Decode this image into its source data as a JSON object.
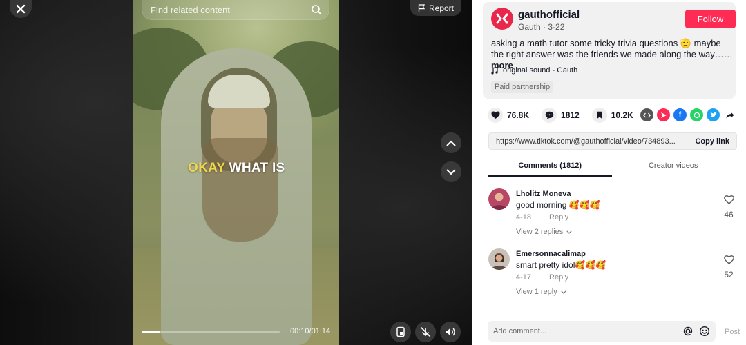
{
  "video": {
    "search_placeholder": "Find related content",
    "report_label": "Report",
    "caption_highlight": "OKAY",
    "caption_rest": "WHAT IS",
    "current_time": "00:10",
    "duration": "01:14",
    "time_display": "00:10/01:14",
    "progress_fraction": 0.135
  },
  "author": {
    "name": "gauthofficial",
    "subtitle": "Gauth · 3-22",
    "follow_label": "Follow",
    "description": "asking a math tutor some tricky trivia questions 🫡 maybe the right answer was the friends we made along the way……",
    "more_label": "more",
    "sound": "original sound - Gauth",
    "paid_label": "Paid partnership",
    "brand_color": "#e8274a"
  },
  "stats": {
    "likes": "76.8K",
    "comments": "1812",
    "saves": "10.2K"
  },
  "share_icons": [
    "embed-icon",
    "send-icon",
    "facebook-icon",
    "whatsapp-icon",
    "twitter-icon",
    "share-arrow-icon"
  ],
  "link": {
    "url": "https://www.tiktok.com/@gauthofficial/video/734893...",
    "copy_label": "Copy link"
  },
  "tabs": [
    {
      "label": "Comments (1812)",
      "active": true
    },
    {
      "label": "Creator videos",
      "active": false
    }
  ],
  "comments": [
    {
      "user": "Lholitz Moneva",
      "text": "good morning 🥰🥰🥰",
      "date": "4-18",
      "reply_label": "Reply",
      "replies_label": "View 2 replies",
      "likes": "46"
    },
    {
      "user": "Emersonnacalimap",
      "text": "smart pretty idol🥰🥰🥰",
      "date": "4-17",
      "reply_label": "Reply",
      "replies_label": "View 1 reply",
      "likes": "52"
    }
  ],
  "composer": {
    "placeholder": "Add comment...",
    "post_label": "Post"
  },
  "colors": {
    "accent": "#fe2c55",
    "caption_yellow": "#f0d64a"
  }
}
